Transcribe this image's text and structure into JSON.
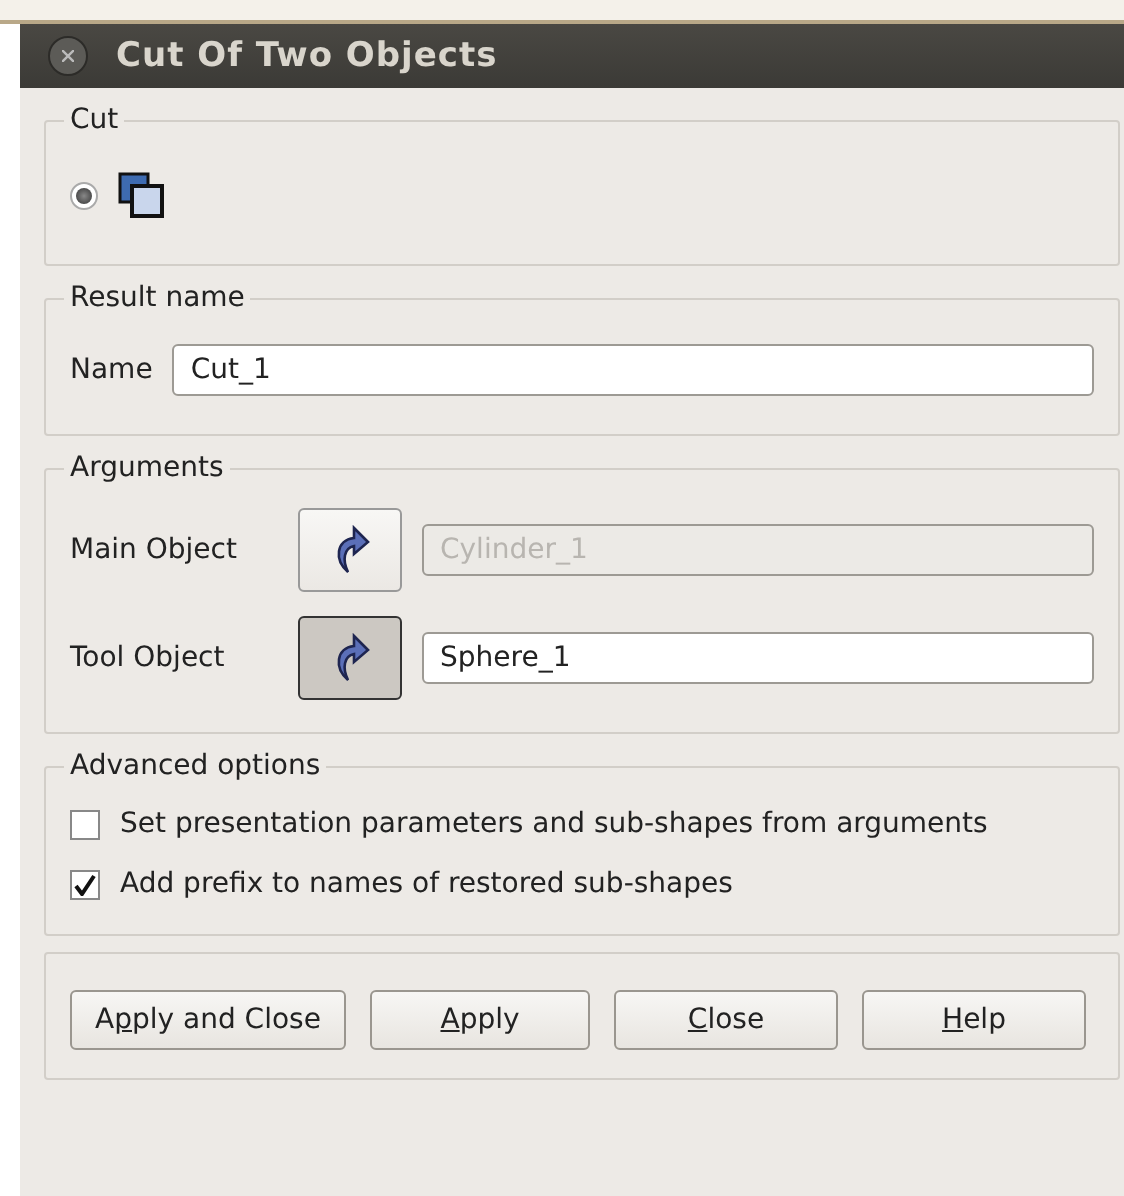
{
  "window": {
    "title": "Cut Of Two Objects"
  },
  "cut": {
    "title": "Cut",
    "option_selected": true
  },
  "result_name": {
    "title": "Result name",
    "label": "Name",
    "value": "Cut_1"
  },
  "arguments": {
    "title": "Arguments",
    "rows": [
      {
        "label": "Main Object",
        "value": "Cylinder_1",
        "selected": false,
        "disabled": true
      },
      {
        "label": "Tool Object",
        "value": "Sphere_1",
        "selected": true,
        "disabled": false
      }
    ]
  },
  "advanced": {
    "title": "Advanced options",
    "options": [
      {
        "label": "Set presentation parameters and sub-shapes from arguments",
        "checked": false
      },
      {
        "label": "Add prefix to names of restored sub-shapes",
        "checked": true
      }
    ]
  },
  "buttons": [
    {
      "before": "A",
      "key": "p",
      "after": "ply and Close"
    },
    {
      "key": "A",
      "after": "pply"
    },
    {
      "key": "C",
      "after": "lose"
    },
    {
      "key": "H",
      "after": "elp"
    }
  ]
}
